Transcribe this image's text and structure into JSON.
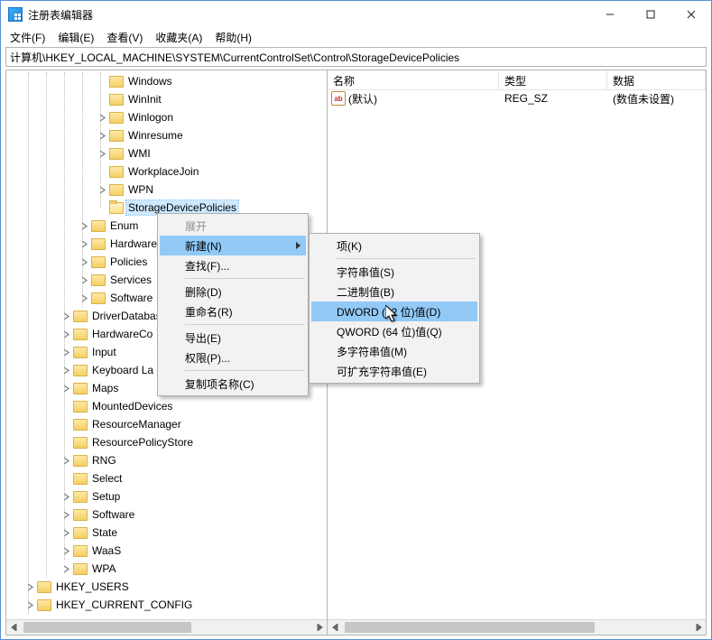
{
  "window": {
    "title": "注册表编辑器"
  },
  "menu": {
    "file": "文件(F)",
    "edit": "编辑(E)",
    "view": "查看(V)",
    "favorites": "收藏夹(A)",
    "help": "帮助(H)"
  },
  "path": "计算机\\HKEY_LOCAL_MACHINE\\SYSTEM\\CurrentControlSet\\Control\\StorageDevicePolicies",
  "columns": {
    "name": "名称",
    "type": "类型",
    "data": "数据"
  },
  "value": {
    "icon_text": "ab",
    "name": "(默认)",
    "type": "REG_SZ",
    "data": "(数值未设置)"
  },
  "tree": {
    "windows": "Windows",
    "wininit": "WinInit",
    "winlogon": "Winlogon",
    "winresume": "Winresume",
    "wmi": "WMI",
    "workplacejoin": "WorkplaceJoin",
    "wpn": "WPN",
    "storagedevicepolicies": "StorageDevicePolicies",
    "enum": "Enum",
    "hardware": "Hardware",
    "policies": "Policies",
    "services": "Services",
    "software": "Software",
    "driverdatabase": "DriverDatabase",
    "hardwareconfig": "HardwareCo",
    "input": "Input",
    "keyboardlayout": "Keyboard La",
    "maps": "Maps",
    "mounteddevices": "MountedDevices",
    "resourcemanager": "ResourceManager",
    "resourcepolicystore": "ResourcePolicyStore",
    "rng": "RNG",
    "select": "Select",
    "setup": "Setup",
    "software2": "Software",
    "state": "State",
    "waas": "WaaS",
    "wpa": "WPA",
    "hkey_users": "HKEY_USERS",
    "hkey_current_config": "HKEY_CURRENT_CONFIG"
  },
  "ctx1": {
    "expand": "展开",
    "new": "新建(N)",
    "find": "查找(F)...",
    "delete": "删除(D)",
    "rename": "重命名(R)",
    "export": "导出(E)",
    "permissions": "权限(P)...",
    "copykeyname": "复制项名称(C)"
  },
  "ctx2": {
    "key": "项(K)",
    "string": "字符串值(S)",
    "binary": "二进制值(B)",
    "dword": "DWORD (32 位)值(D)",
    "qword": "QWORD (64 位)值(Q)",
    "multistring": "多字符串值(M)",
    "expandstring": "可扩充字符串值(E)"
  }
}
